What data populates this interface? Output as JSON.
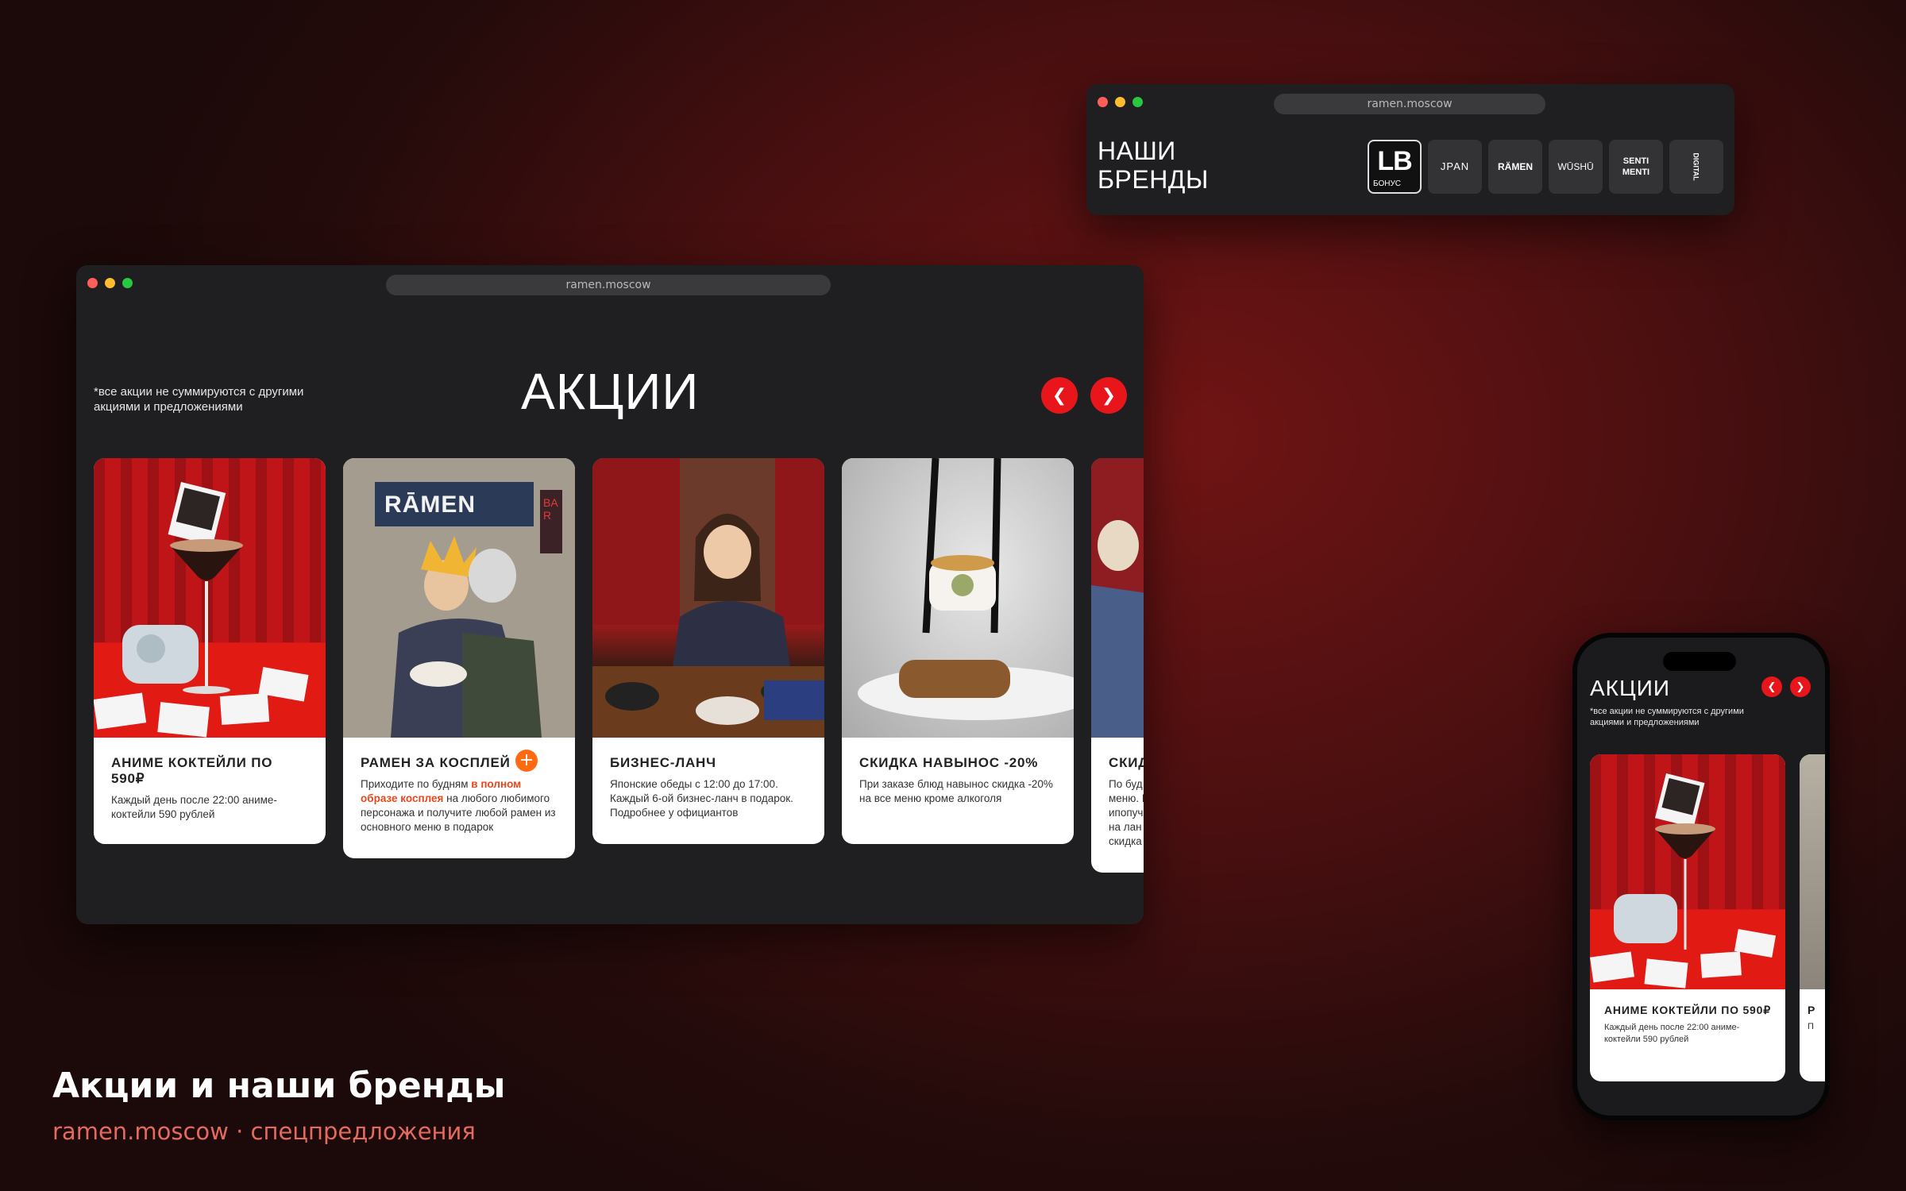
{
  "brands_window": {
    "url": "ramen.moscow",
    "title_line1": "НАШИ",
    "title_line2": "БРЕНДЫ",
    "brands": [
      {
        "logo": "LB",
        "sub": "БОНУС",
        "active": true
      },
      {
        "logo": "JPAN"
      },
      {
        "logo": "RÄMEN"
      },
      {
        "logo": "WŪSHŪ"
      },
      {
        "logo": "SENTI MENTI"
      },
      {
        "logo": "DIGITAL"
      }
    ]
  },
  "promo_window": {
    "url": "ramen.moscow",
    "note": "*все акции не суммируются с другими акциями и предложениями",
    "title": "АКЦИИ",
    "prev_icon": "chevron-left-icon",
    "next_icon": "chevron-right-icon",
    "cards": [
      {
        "title": "АНИМЕ КОКТЕЙЛИ ПО 590₽",
        "text": "Каждый день после 22:00 аниме-коктейли 590 рублей"
      },
      {
        "title": "РАМЕН ЗА КОСПЛЕЙ",
        "text_pre": "Приходите по будням ",
        "text_hl": "в полном образе косплея",
        "text_post": " на любого любимого персонажа и получите любой рамен из основного меню в подарок",
        "photo_sign": "RĀMEN",
        "photo_sign2": "BAR"
      },
      {
        "title": "БИЗНЕС-ЛАНЧ",
        "text": "Японские обеды с 12:00 до 17:00. Каждый 6-ой бизнес-ланч в подарок. Подробнее у официантов"
      },
      {
        "title": "СКИДКА НАВЫНОС -20%",
        "text": "При заказе блюд навынос скидка -20% на все меню кроме алкоголя"
      },
      {
        "title": "СКИД",
        "text": "По буд меню. П ипопуч на лан скидка"
      }
    ]
  },
  "phone": {
    "title": "АКЦИИ",
    "note": "*все акции не суммируются с другими акциями и предложениями",
    "card": {
      "title": "АНИМЕ КОКТЕЙЛИ ПО 590₽",
      "text": "Каждый день после 22:00 аниме-коктейли 590 рублей"
    },
    "peek_title": "Р",
    "peek_text": "П"
  },
  "caption": {
    "title": "Акции и наши бренды",
    "subtitle": "ramen.moscow · спецпредложения"
  },
  "colors": {
    "accent_red": "#e8161b",
    "highlight_orange": "#e8461b",
    "plus_orange": "#ff6a13",
    "window_bg": "#1f1f21"
  }
}
